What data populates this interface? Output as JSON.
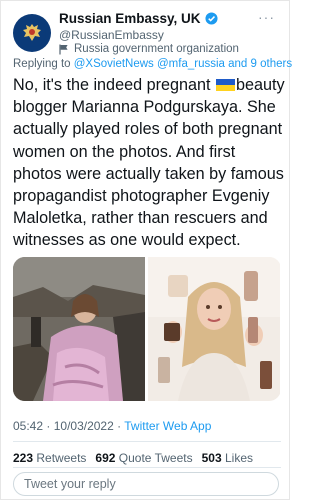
{
  "author": {
    "name": "Russian Embassy, UK",
    "handle": "@RussianEmbassy",
    "label": "Russia government organization",
    "verified_icon": "verified-badge-icon",
    "label_icon": "flag-icon",
    "avatar_icon": "coat-of-arms-icon"
  },
  "menu": {
    "more_icon": "more-icon",
    "more_text": "···"
  },
  "reply_to": {
    "prefix": "Replying to",
    "mentions": "@XSovietNews @mfa_russia",
    "and_others": "and 9 others"
  },
  "tweet": {
    "text_part1": "No, it's the indeed pregnant",
    "flag_icon": "ukraine-flag-icon",
    "text_part2": "beauty blogger Marianna Podgurskaya. She actually played roles of both pregnant women on the photos. And first photos were actually taken by famous propagandist photographer Evgeniy Maloletka, rather than rescuers and witnesses as one would expect."
  },
  "meta": {
    "time": "05:42",
    "separator": "·",
    "date": "10/03/2022",
    "separator2": "·",
    "source": "Twitter Web App"
  },
  "stats": {
    "retweets_count": "223",
    "retweets_label": "Retweets",
    "quotes_count": "692",
    "quotes_label": "Quote Tweets",
    "likes_count": "503",
    "likes_label": "Likes"
  },
  "reply_box": {
    "placeholder": "Tweet your reply"
  },
  "colors": {
    "accent": "#1d9bf0",
    "text": "#0f1419",
    "muted": "#536471",
    "avatar_bg": "#0b3a78"
  }
}
